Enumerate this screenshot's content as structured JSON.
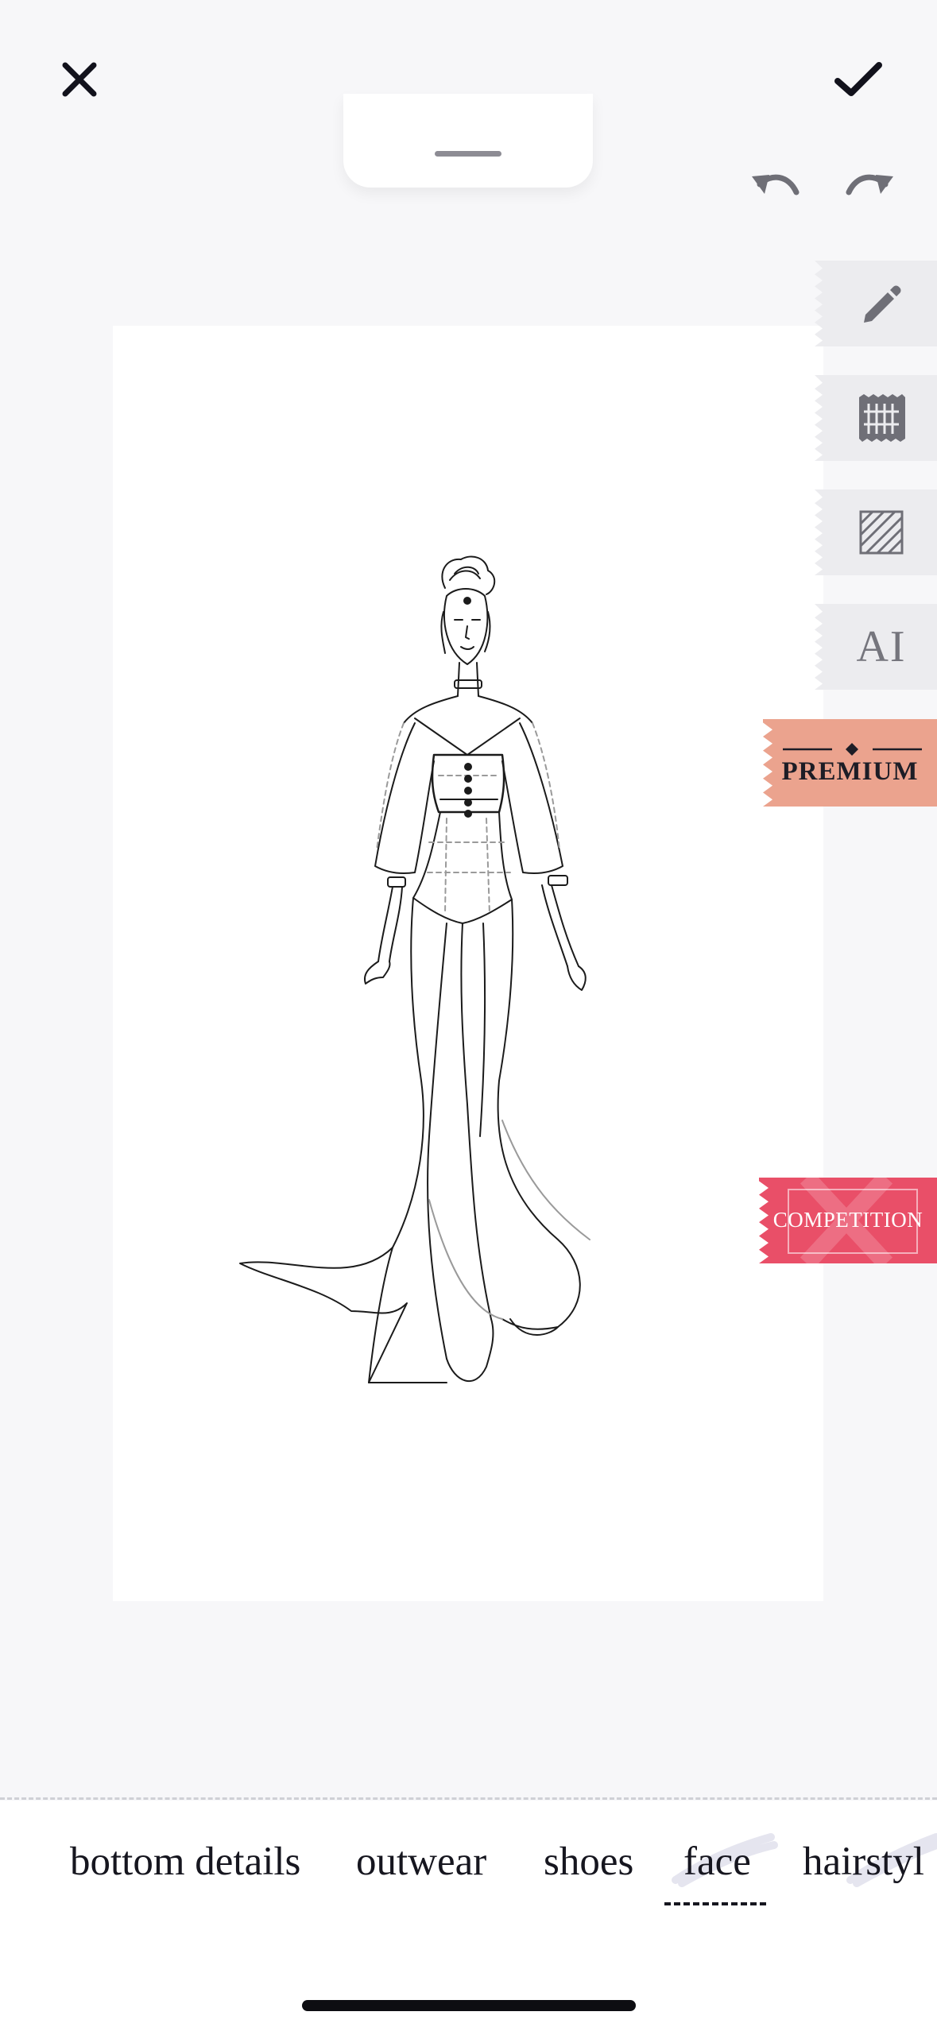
{
  "toolbar": {
    "close_icon": "close-icon",
    "confirm_icon": "checkmark-icon",
    "undo_icon": "undo-icon",
    "redo_icon": "redo-icon",
    "handle_icon": "drag-handle-icon"
  },
  "tools": {
    "pencil_icon": "pencil-icon",
    "fabric_icon": "fabric-swatch-icon",
    "pattern_icon": "stripe-pattern-icon",
    "ai_label": "AI"
  },
  "badges": {
    "premium_label": "PREMIUM",
    "competition_label": "COMPETITION"
  },
  "categories": [
    "bottom details",
    "outwear",
    "shoes",
    "face",
    "hairstyl"
  ],
  "selected_category": "face",
  "colors": {
    "premium": "#eba38e",
    "competition": "#e94f68",
    "text_dark": "#16161f",
    "tool_bg": "#ececef"
  }
}
